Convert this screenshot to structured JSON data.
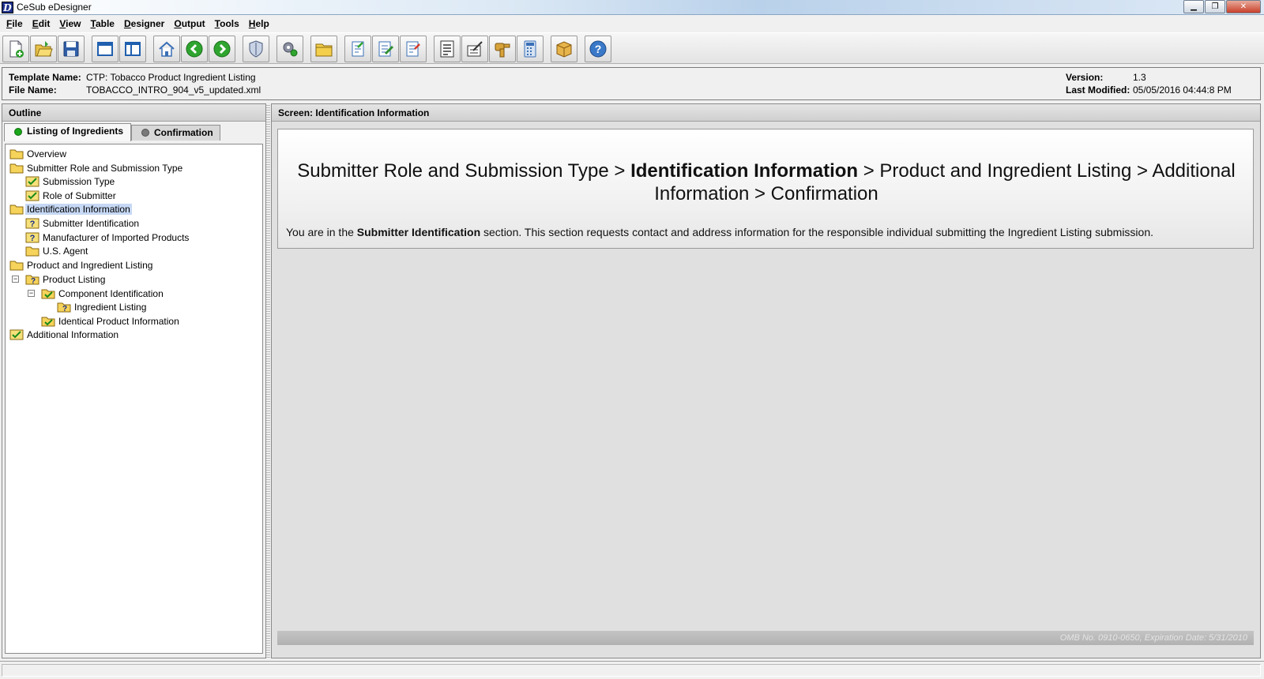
{
  "window": {
    "title": "CeSub eDesigner",
    "logo_letter": "D",
    "controls": [
      "minimize",
      "maximize",
      "close"
    ]
  },
  "menu": [
    {
      "label": "File",
      "accel": "F",
      "rest": "ile"
    },
    {
      "label": "Edit",
      "accel": "E",
      "rest": "dit"
    },
    {
      "label": "View",
      "accel": "V",
      "rest": "iew"
    },
    {
      "label": "Table",
      "accel": "T",
      "rest": "able"
    },
    {
      "label": "Designer",
      "accel": "D",
      "rest": "esigner"
    },
    {
      "label": "Output",
      "accel": "O",
      "rest": "utput"
    },
    {
      "label": "Tools",
      "accel": "T",
      "rest": "ools"
    },
    {
      "label": "Help",
      "accel": "H",
      "rest": "elp"
    }
  ],
  "toolbar": {
    "icons": [
      "new-document-icon",
      "open-folder-icon",
      "save-icon",
      "window-icon",
      "split-panes-icon",
      "home-icon",
      "back-arrow-icon",
      "forward-arrow-icon",
      "shield-icon",
      "gears-icon",
      "folder-icon",
      "import-icon",
      "edit-icon",
      "export-icon",
      "form-icon",
      "edit-tool-icon",
      "key-icon",
      "calculator-icon",
      "package-icon",
      "help-icon"
    ]
  },
  "info": {
    "template_label": "Template Name:",
    "template_value": "CTP: Tobacco Product Ingredient Listing",
    "file_label": "File Name:",
    "file_value": "TOBACCO_INTRO_904_v5_updated.xml",
    "version_label": "Version:",
    "version_value": "1.3",
    "modified_label": "Last Modified:",
    "modified_value": "05/05/2016 04:44:8 PM"
  },
  "outline": {
    "title": "Outline",
    "tabs": [
      {
        "label": "Listing of Ingredients",
        "status_color": "#1aa51a"
      },
      {
        "label": "Confirmation",
        "status_color": "#7a7a7a"
      }
    ],
    "tree": [
      {
        "label": "Overview",
        "icon": "folder-icon"
      },
      {
        "label": "Submitter Role and Submission Type",
        "icon": "folder-icon"
      },
      {
        "label": "Submission Type",
        "icon": "check-icon"
      },
      {
        "label": "Role of Submitter",
        "icon": "check-icon"
      },
      {
        "label": "Identification Information",
        "icon": "folder-icon",
        "selected": true
      },
      {
        "label": "Submitter Identification",
        "icon": "question-icon"
      },
      {
        "label": "Manufacturer of Imported Products",
        "icon": "question-icon"
      },
      {
        "label": "U.S. Agent",
        "icon": "folder-icon"
      },
      {
        "label": "Product and Ingredient Listing",
        "icon": "folder-icon"
      },
      {
        "label": "Product Listing",
        "icon": "folder-question-icon",
        "expander": "−"
      },
      {
        "label": "Component Identification",
        "icon": "folder-check-icon",
        "expander": "−"
      },
      {
        "label": "Ingredient Listing",
        "icon": "folder-question-icon"
      },
      {
        "label": "Identical Product Information",
        "icon": "folder-check-icon"
      },
      {
        "label": "Additional Information",
        "icon": "check-icon"
      }
    ]
  },
  "screen": {
    "header": "Screen: Identification Information",
    "breadcrumb": {
      "part1": "Submitter Role and Submission Type >",
      "current": "Identification Information",
      "part2": "> Product and Ingredient Listing > Additional Information > Confirmation"
    },
    "note": {
      "prefix": "You are in the",
      "section": "Submitter Identification",
      "suffix": "section. This section requests contact and address information for the responsible individual submitting the Ingredient Listing submission."
    },
    "omb": "OMB No. 0910-0650, Expiration Date: 5/31/2010"
  }
}
